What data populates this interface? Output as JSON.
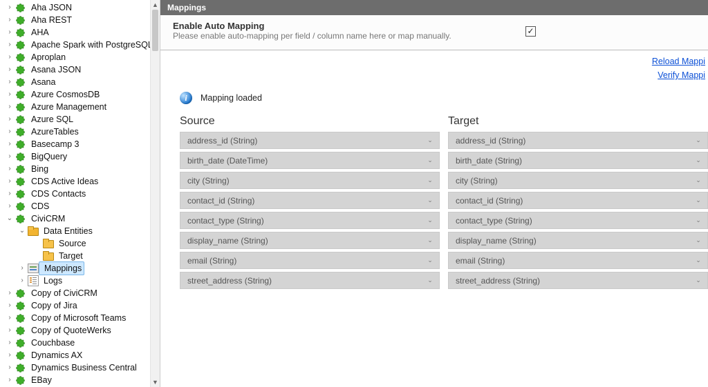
{
  "sidebar": {
    "items": [
      {
        "label": "Aha JSON",
        "icon": "puzzle",
        "expander": ">",
        "indent": 0
      },
      {
        "label": "Aha REST",
        "icon": "puzzle",
        "expander": ">",
        "indent": 0
      },
      {
        "label": "AHA",
        "icon": "puzzle",
        "expander": ">",
        "indent": 0
      },
      {
        "label": "Apache Spark with PostgreSQL",
        "icon": "puzzle",
        "expander": ">",
        "indent": 0
      },
      {
        "label": "Aproplan",
        "icon": "puzzle",
        "expander": ">",
        "indent": 0
      },
      {
        "label": "Asana JSON",
        "icon": "puzzle",
        "expander": ">",
        "indent": 0
      },
      {
        "label": "Asana",
        "icon": "puzzle",
        "expander": ">",
        "indent": 0
      },
      {
        "label": "Azure CosmosDB",
        "icon": "puzzle",
        "expander": ">",
        "indent": 0
      },
      {
        "label": "Azure Management",
        "icon": "puzzle",
        "expander": ">",
        "indent": 0
      },
      {
        "label": "Azure SQL",
        "icon": "puzzle",
        "expander": ">",
        "indent": 0
      },
      {
        "label": "AzureTables",
        "icon": "puzzle",
        "expander": ">",
        "indent": 0
      },
      {
        "label": "Basecamp 3",
        "icon": "puzzle",
        "expander": ">",
        "indent": 0
      },
      {
        "label": "BigQuery",
        "icon": "puzzle",
        "expander": ">",
        "indent": 0
      },
      {
        "label": "Bing",
        "icon": "puzzle",
        "expander": ">",
        "indent": 0
      },
      {
        "label": "CDS Active Ideas",
        "icon": "puzzle",
        "expander": ">",
        "indent": 0
      },
      {
        "label": "CDS Contacts",
        "icon": "puzzle",
        "expander": ">",
        "indent": 0
      },
      {
        "label": "CDS",
        "icon": "puzzle",
        "expander": ">",
        "indent": 0
      },
      {
        "label": "CiviCRM",
        "icon": "puzzle",
        "expander": "v",
        "indent": 0
      },
      {
        "label": "Data Entities",
        "icon": "folder-db",
        "expander": "v",
        "indent": 1
      },
      {
        "label": "Source",
        "icon": "folder",
        "expander": "",
        "indent": 2
      },
      {
        "label": "Target",
        "icon": "folder",
        "expander": "",
        "indent": 2
      },
      {
        "label": "Mappings",
        "icon": "map",
        "expander": ">",
        "indent": 1,
        "selected": true
      },
      {
        "label": "Logs",
        "icon": "logs",
        "expander": ">",
        "indent": 1
      },
      {
        "label": "Copy of CiviCRM",
        "icon": "puzzle",
        "expander": ">",
        "indent": 0
      },
      {
        "label": "Copy of Jira",
        "icon": "puzzle",
        "expander": ">",
        "indent": 0
      },
      {
        "label": "Copy of Microsoft Teams",
        "icon": "puzzle",
        "expander": ">",
        "indent": 0
      },
      {
        "label": "Copy of QuoteWerks",
        "icon": "puzzle",
        "expander": ">",
        "indent": 0
      },
      {
        "label": "Couchbase",
        "icon": "puzzle",
        "expander": ">",
        "indent": 0
      },
      {
        "label": "Dynamics AX",
        "icon": "puzzle",
        "expander": ">",
        "indent": 0
      },
      {
        "label": "Dynamics Business Central",
        "icon": "puzzle",
        "expander": ">",
        "indent": 0
      },
      {
        "label": "EBay",
        "icon": "puzzle",
        "expander": ">",
        "indent": 0
      }
    ]
  },
  "main": {
    "title": "Mappings",
    "automap": {
      "heading": "Enable Auto Mapping",
      "desc": "Please enable auto-mapping per field / column name here or map manually.",
      "checked": true
    },
    "links": {
      "reload": "Reload Mappi",
      "verify": "Verify Mappi"
    },
    "status": "Mapping loaded",
    "source_heading": "Source",
    "target_heading": "Target",
    "mappings": [
      {
        "source": "address_id (String)",
        "target": "address_id (String)"
      },
      {
        "source": "birth_date (DateTime)",
        "target": "birth_date (String)"
      },
      {
        "source": "city (String)",
        "target": "city (String)"
      },
      {
        "source": "contact_id (String)",
        "target": "contact_id (String)"
      },
      {
        "source": "contact_type (String)",
        "target": "contact_type (String)"
      },
      {
        "source": "display_name (String)",
        "target": "display_name (String)"
      },
      {
        "source": "email (String)",
        "target": "email (String)"
      },
      {
        "source": "street_address (String)",
        "target": "street_address (String)"
      }
    ]
  }
}
